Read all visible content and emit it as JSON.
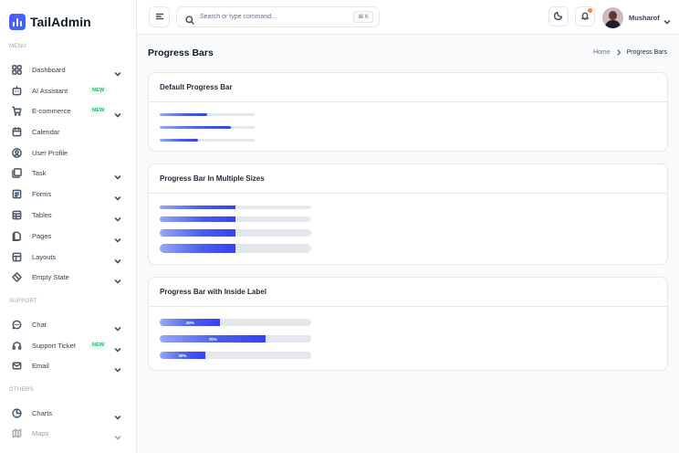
{
  "app": {
    "name": "TailAdmin"
  },
  "sidebar": {
    "menu_label": "MENU",
    "support_label": "SUPPORT",
    "others_label": "OTHERS",
    "menu": [
      {
        "label": "Dashboard",
        "icon": "grid-icon",
        "chevron": true
      },
      {
        "label": "AI Assistant",
        "icon": "ai-icon",
        "badge": "NEW"
      },
      {
        "label": "E-commerce",
        "icon": "cart-icon",
        "badge": "NEW",
        "chevron": true
      },
      {
        "label": "Calendar",
        "icon": "calendar-icon"
      },
      {
        "label": "User Profile",
        "icon": "user-circle-icon"
      },
      {
        "label": "Task",
        "icon": "task-icon",
        "chevron": true
      },
      {
        "label": "Forms",
        "icon": "form-icon",
        "chevron": true
      },
      {
        "label": "Tables",
        "icon": "table-icon",
        "chevron": true
      },
      {
        "label": "Pages",
        "icon": "pages-icon",
        "chevron": true
      },
      {
        "label": "Layouts",
        "icon": "layout-icon",
        "chevron": true
      },
      {
        "label": "Empty State",
        "icon": "empty-state-icon",
        "chevron": true
      }
    ],
    "support": [
      {
        "label": "Chat",
        "icon": "chat-icon",
        "chevron": true
      },
      {
        "label": "Support Ticket",
        "icon": "headset-icon",
        "badge": "NEW",
        "chevron": true
      },
      {
        "label": "Email",
        "icon": "mail-icon",
        "chevron": true
      }
    ],
    "others": [
      {
        "label": "Charts",
        "icon": "pie-chart-icon",
        "chevron": true
      },
      {
        "label": "Maps",
        "icon": "map-icon",
        "chevron": true
      }
    ]
  },
  "header": {
    "search_placeholder": "Search or type command...",
    "shortcut": "⌘ K",
    "user_name": "Musharof"
  },
  "page": {
    "title": "Progress Bars",
    "breadcrumb_home": "Home",
    "breadcrumb_current": "Progress Bars"
  },
  "cards": [
    {
      "title": "Default Progress Bar",
      "bars": [
        {
          "percent": 50
        },
        {
          "percent": 75
        },
        {
          "percent": 40
        }
      ]
    },
    {
      "title": "Progress Bar In Multiple Sizes",
      "bars": [
        {
          "percent": 50
        },
        {
          "percent": 50
        },
        {
          "percent": 50
        },
        {
          "percent": 50
        }
      ]
    },
    {
      "title": "Progress Bar with Inside Label",
      "bars": [
        {
          "percent": 40,
          "label": "40%"
        },
        {
          "percent": 70,
          "label": "70%"
        },
        {
          "percent": 30,
          "label": "30%"
        }
      ]
    }
  ],
  "colors": {
    "accent": "#465fff",
    "bar_start": "#97a7f8",
    "bar_end": "#3641f5",
    "track": "#e4e7ec",
    "badge_text": "#12b76a",
    "notification_dot": "#fd853a"
  }
}
